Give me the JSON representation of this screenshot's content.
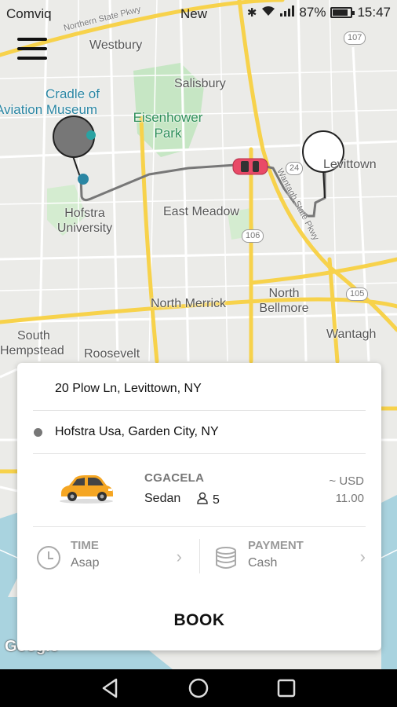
{
  "status_bar": {
    "carrier": "Comviq",
    "extra_text": "New",
    "battery_percent": "87%",
    "battery_level": 0.87,
    "time": "15:47"
  },
  "map": {
    "labels": {
      "westbury": "Westbury",
      "salisbury": "Salisbury",
      "cradle_line1": "Cradle of",
      "cradle_line2": "Aviation Museum",
      "eisenhower_line1": "Eisenhower",
      "eisenhower_line2": "Park",
      "levittown": "Levittown",
      "hofstra_line1": "Hofstra",
      "hofstra_line2": "University",
      "east_meadow": "East Meadow",
      "north_merrick": "North Merrick",
      "north_bellmore_line1": "North",
      "north_bellmore_line2": "Bellmore",
      "wantagh": "Wantagh",
      "south_hempstead_line1": "South",
      "south_hempstead_line2": "Hempstead",
      "roosevelt": "Roosevelt",
      "northern_state_pkwy": "Northern State Pkwy",
      "wantagh_state_pkwy": "Wantagh State Pkwy",
      "route_107": "107",
      "route_24": "24",
      "route_106": "106",
      "route_105": "105"
    },
    "attribution": "Google"
  },
  "trip": {
    "pickup_address": "20 Plow Ln, Levittown, NY",
    "dropoff_address": "Hofstra Usa, Garden City, NY"
  },
  "vehicle": {
    "name": "CGACELA",
    "type": "Sedan",
    "seats": "5",
    "price_line1": "~ USD",
    "price_line2": "11.00"
  },
  "options": {
    "time_label": "TIME",
    "time_value": "Asap",
    "payment_label": "PAYMENT",
    "payment_value": "Cash"
  },
  "book_label": "BOOK",
  "colors": {
    "map_bg": "#ebebe8",
    "highway": "#f7d24b",
    "park": "#c6e6c4",
    "water": "#a9d3df",
    "route": "#777777",
    "car": "#e94a67",
    "taxi": "#f5a623"
  }
}
